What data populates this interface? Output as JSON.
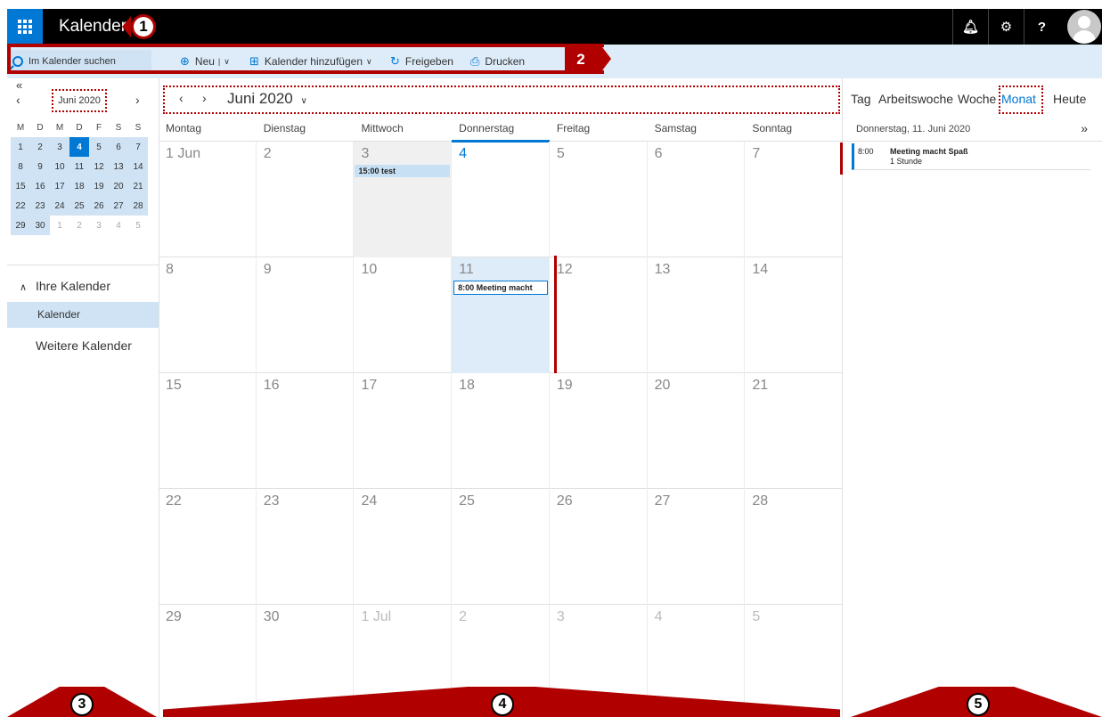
{
  "header": {
    "app_title": "Kalender",
    "icons": [
      "waffle-icon",
      "bell-icon",
      "gear-icon",
      "help-icon",
      "avatar"
    ]
  },
  "toolbar": {
    "search_placeholder": "Im Kalender suchen",
    "new_label": "Neu",
    "add_calendar_label": "Kalender hinzufügen",
    "share_label": "Freigeben",
    "print_label": "Drucken"
  },
  "mini_calendar": {
    "month_label": "Juni 2020",
    "weekday_headers": [
      "M",
      "D",
      "M",
      "D",
      "F",
      "S",
      "S"
    ],
    "weeks": [
      [
        "1",
        "2",
        "3",
        "4",
        "5",
        "6",
        "7"
      ],
      [
        "8",
        "9",
        "10",
        "11",
        "12",
        "13",
        "14"
      ],
      [
        "15",
        "16",
        "17",
        "18",
        "19",
        "20",
        "21"
      ],
      [
        "22",
        "23",
        "24",
        "25",
        "26",
        "27",
        "28"
      ],
      [
        "29",
        "30",
        "1",
        "2",
        "3",
        "4",
        "5"
      ]
    ],
    "today": "4"
  },
  "sidebar": {
    "section_label": "Ihre Kalender",
    "calendar_item": "Kalender",
    "more_calendars": "Weitere Kalender"
  },
  "main": {
    "month_label": "Juni 2020",
    "views": [
      "Tag",
      "Arbeitswoche",
      "Woche",
      "Monat",
      "Heute"
    ],
    "active_view": "Monat",
    "day_headers": [
      "Montag",
      "Dienstag",
      "Mittwoch",
      "Donnerstag",
      "Freitag",
      "Samstag",
      "Sonntag"
    ],
    "weeks": [
      [
        "1 Jun",
        "2",
        "3",
        "4",
        "5",
        "6",
        "7"
      ],
      [
        "8",
        "9",
        "10",
        "11",
        "12",
        "13",
        "14"
      ],
      [
        "15",
        "16",
        "17",
        "18",
        "19",
        "20",
        "21"
      ],
      [
        "22",
        "23",
        "24",
        "25",
        "26",
        "27",
        "28"
      ],
      [
        "29",
        "30",
        "1 Jul",
        "2",
        "3",
        "4",
        "5"
      ]
    ],
    "events": [
      {
        "label": "15:00 test"
      },
      {
        "label": "8:00 Meeting macht"
      }
    ]
  },
  "agenda": {
    "date_label": "Donnerstag, 11. Juni 2020",
    "expand_glyph": "»",
    "item_time": "8:00",
    "item_title": "Meeting macht Spaß",
    "item_duration": "1 Stunde"
  },
  "annotations": [
    "1",
    "2",
    "3",
    "4",
    "5"
  ],
  "colors": {
    "accent": "#0078d4",
    "annotation": "#b00000",
    "topbar": "#000000",
    "commandbar": "#deecf9"
  }
}
